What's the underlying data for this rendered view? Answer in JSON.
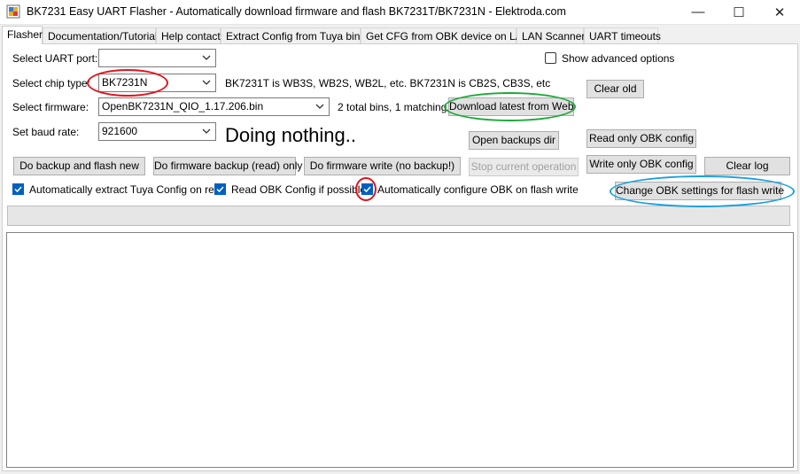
{
  "window": {
    "title": "BK7231 Easy UART Flasher - Automatically download firmware and flash BK7231T/BK7231N  - Elektroda.com",
    "minimize": "—",
    "maximize": "☐",
    "close": "✕"
  },
  "tabs": [
    {
      "label": "Flasher",
      "active": true
    },
    {
      "label": "Documentation/Tutorials"
    },
    {
      "label": "Help contact"
    },
    {
      "label": "Extract Config from Tuya binary"
    },
    {
      "label": "Get CFG from OBK device on LAN"
    },
    {
      "label": "LAN Scanner"
    },
    {
      "label": "UART timeouts"
    }
  ],
  "form": {
    "uart_label": "Select UART port:",
    "uart_value": "",
    "chip_label": "Select chip type:",
    "chip_value": "BK7231N",
    "chip_info": "BK7231T is WB3S, WB2S, WB2L, etc. BK7231N is CB2S, CB3S, etc",
    "firmware_label": "Select firmware:",
    "firmware_value": "OpenBK7231N_QIO_1.17.206.bin",
    "firmware_info": "2 total bins, 1 matching.",
    "baud_label": "Set baud rate:",
    "baud_value": "921600",
    "status": "Doing nothing..",
    "show_advanced": "Show advanced options"
  },
  "buttons": {
    "clear_old": "Clear old",
    "download_latest": "Download latest from Web",
    "open_backups": "Open backups dir",
    "read_only_obk": "Read only OBK config",
    "write_only_obk": "Write only OBK config",
    "clear_log": "Clear log",
    "backup_and_flash": "Do backup and flash new",
    "firmware_backup": "Do firmware backup (read) only",
    "firmware_write": "Do firmware write (no backup!)",
    "stop": "Stop current operation",
    "change_obk": "Change OBK settings for flash write"
  },
  "checkboxes": {
    "extract_tuya": "Automatically extract Tuya Config on read",
    "read_obk": "Read OBK Config if possible",
    "auto_configure": "Automatically configure OBK on flash write"
  },
  "progress": 0,
  "colors": {
    "annotation_red": "#e0141e",
    "annotation_green": "#1fa83a",
    "annotation_blue": "#1aa0e0",
    "checkbox_blue": "#0060c0"
  }
}
